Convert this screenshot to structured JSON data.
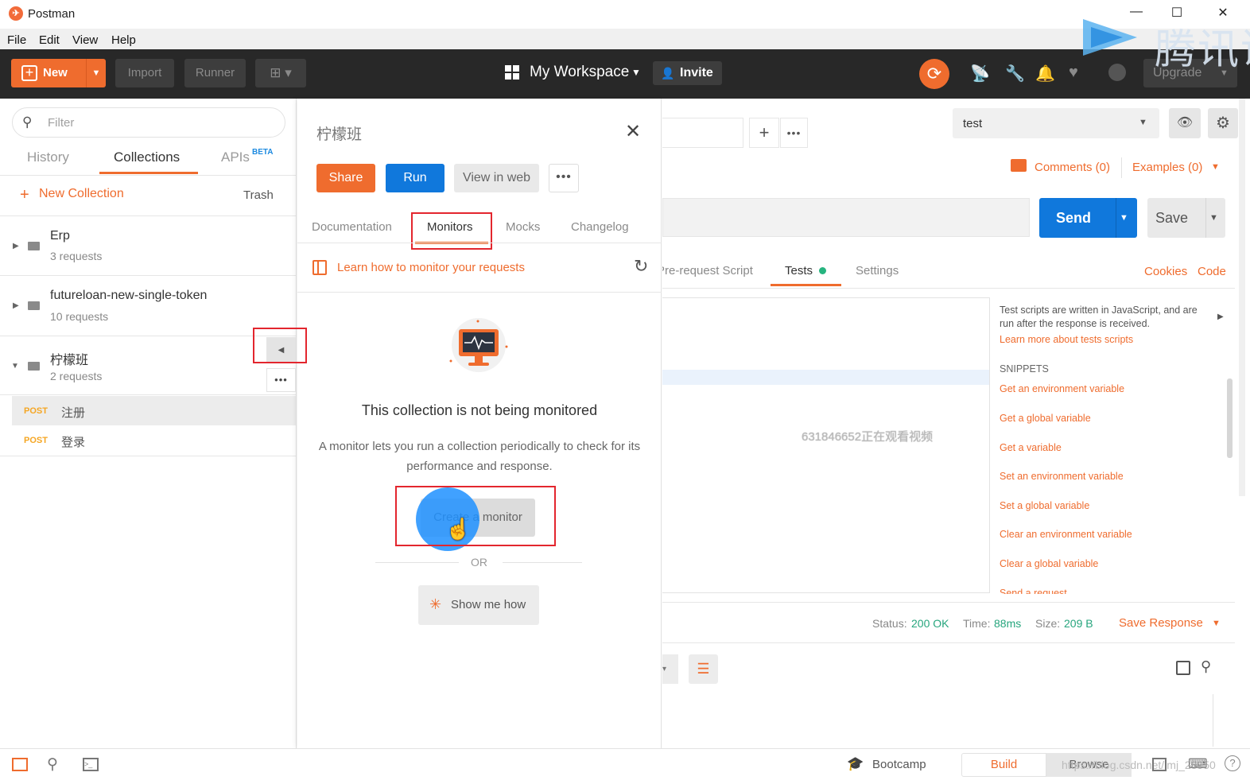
{
  "window": {
    "title": "Postman"
  },
  "menu": [
    "File",
    "Edit",
    "View",
    "Help"
  ],
  "header": {
    "new_label": "New",
    "import_label": "Import",
    "runner_label": "Runner",
    "workspace_label": "My Workspace",
    "invite_label": "Invite",
    "upgrade_label": "Upgrade",
    "accent_color": "#ef6c2e"
  },
  "overlay": {
    "tencent_text": "腾讯课"
  },
  "sidebar": {
    "filter_placeholder": "Filter",
    "tabs": [
      "History",
      "Collections",
      "APIs"
    ],
    "apis_badge": "BETA",
    "new_collection_label": "New Collection",
    "trash_label": "Trash",
    "collections": [
      {
        "name": "Erp",
        "count": "3 requests"
      },
      {
        "name": "futureloan-new-single-token",
        "count": "10 requests"
      },
      {
        "name": "柠檬班",
        "count": "2 requests"
      }
    ],
    "requests": [
      {
        "method": "POST",
        "name": "注册"
      },
      {
        "method": "POST",
        "name": "登录"
      }
    ]
  },
  "collection_panel": {
    "title": "柠檬班",
    "share_label": "Share",
    "run_label": "Run",
    "view_web_label": "View in web",
    "tabs": [
      "Documentation",
      "Monitors",
      "Mocks",
      "Changelog"
    ],
    "learn_link": "Learn how to monitor your requests",
    "heading": "This collection is not being monitored",
    "description": "A monitor lets you run a collection periodically to check for its performance and response.",
    "create_label": "Create a monitor",
    "or_label": "OR",
    "show_me_label": "Show me how"
  },
  "request": {
    "environment": "test",
    "comments_label": "Comments (0)",
    "examples_label": "Examples (0)",
    "send_label": "Send",
    "save_label": "Save",
    "tabs": [
      "Pre-request Script",
      "Tests",
      "Settings"
    ],
    "cookies_label": "Cookies",
    "code_label": "Code",
    "watermark": "631846652正在观看视频"
  },
  "snippets": {
    "description": "Test scripts are written in JavaScript, and are run after the response is received.",
    "learn_more": "Learn more about tests scripts",
    "heading": "SNIPPETS",
    "items": [
      "Get an environment variable",
      "Get a global variable",
      "Get a variable",
      "Set an environment variable",
      "Set a global variable",
      "Clear an environment variable",
      "Clear a global variable",
      "Send a request"
    ]
  },
  "response": {
    "status_key": "Status:",
    "status_val": "200 OK",
    "time_key": "Time:",
    "time_val": "88ms",
    "size_key": "Size:",
    "size_val": "209 B",
    "save_response_label": "Save Response"
  },
  "footer": {
    "bootcamp_label": "Bootcamp",
    "build_label": "Build",
    "browse_label": "Browse",
    "csdn_watermark": "https://blog.csdn.net/jmj_28950"
  }
}
